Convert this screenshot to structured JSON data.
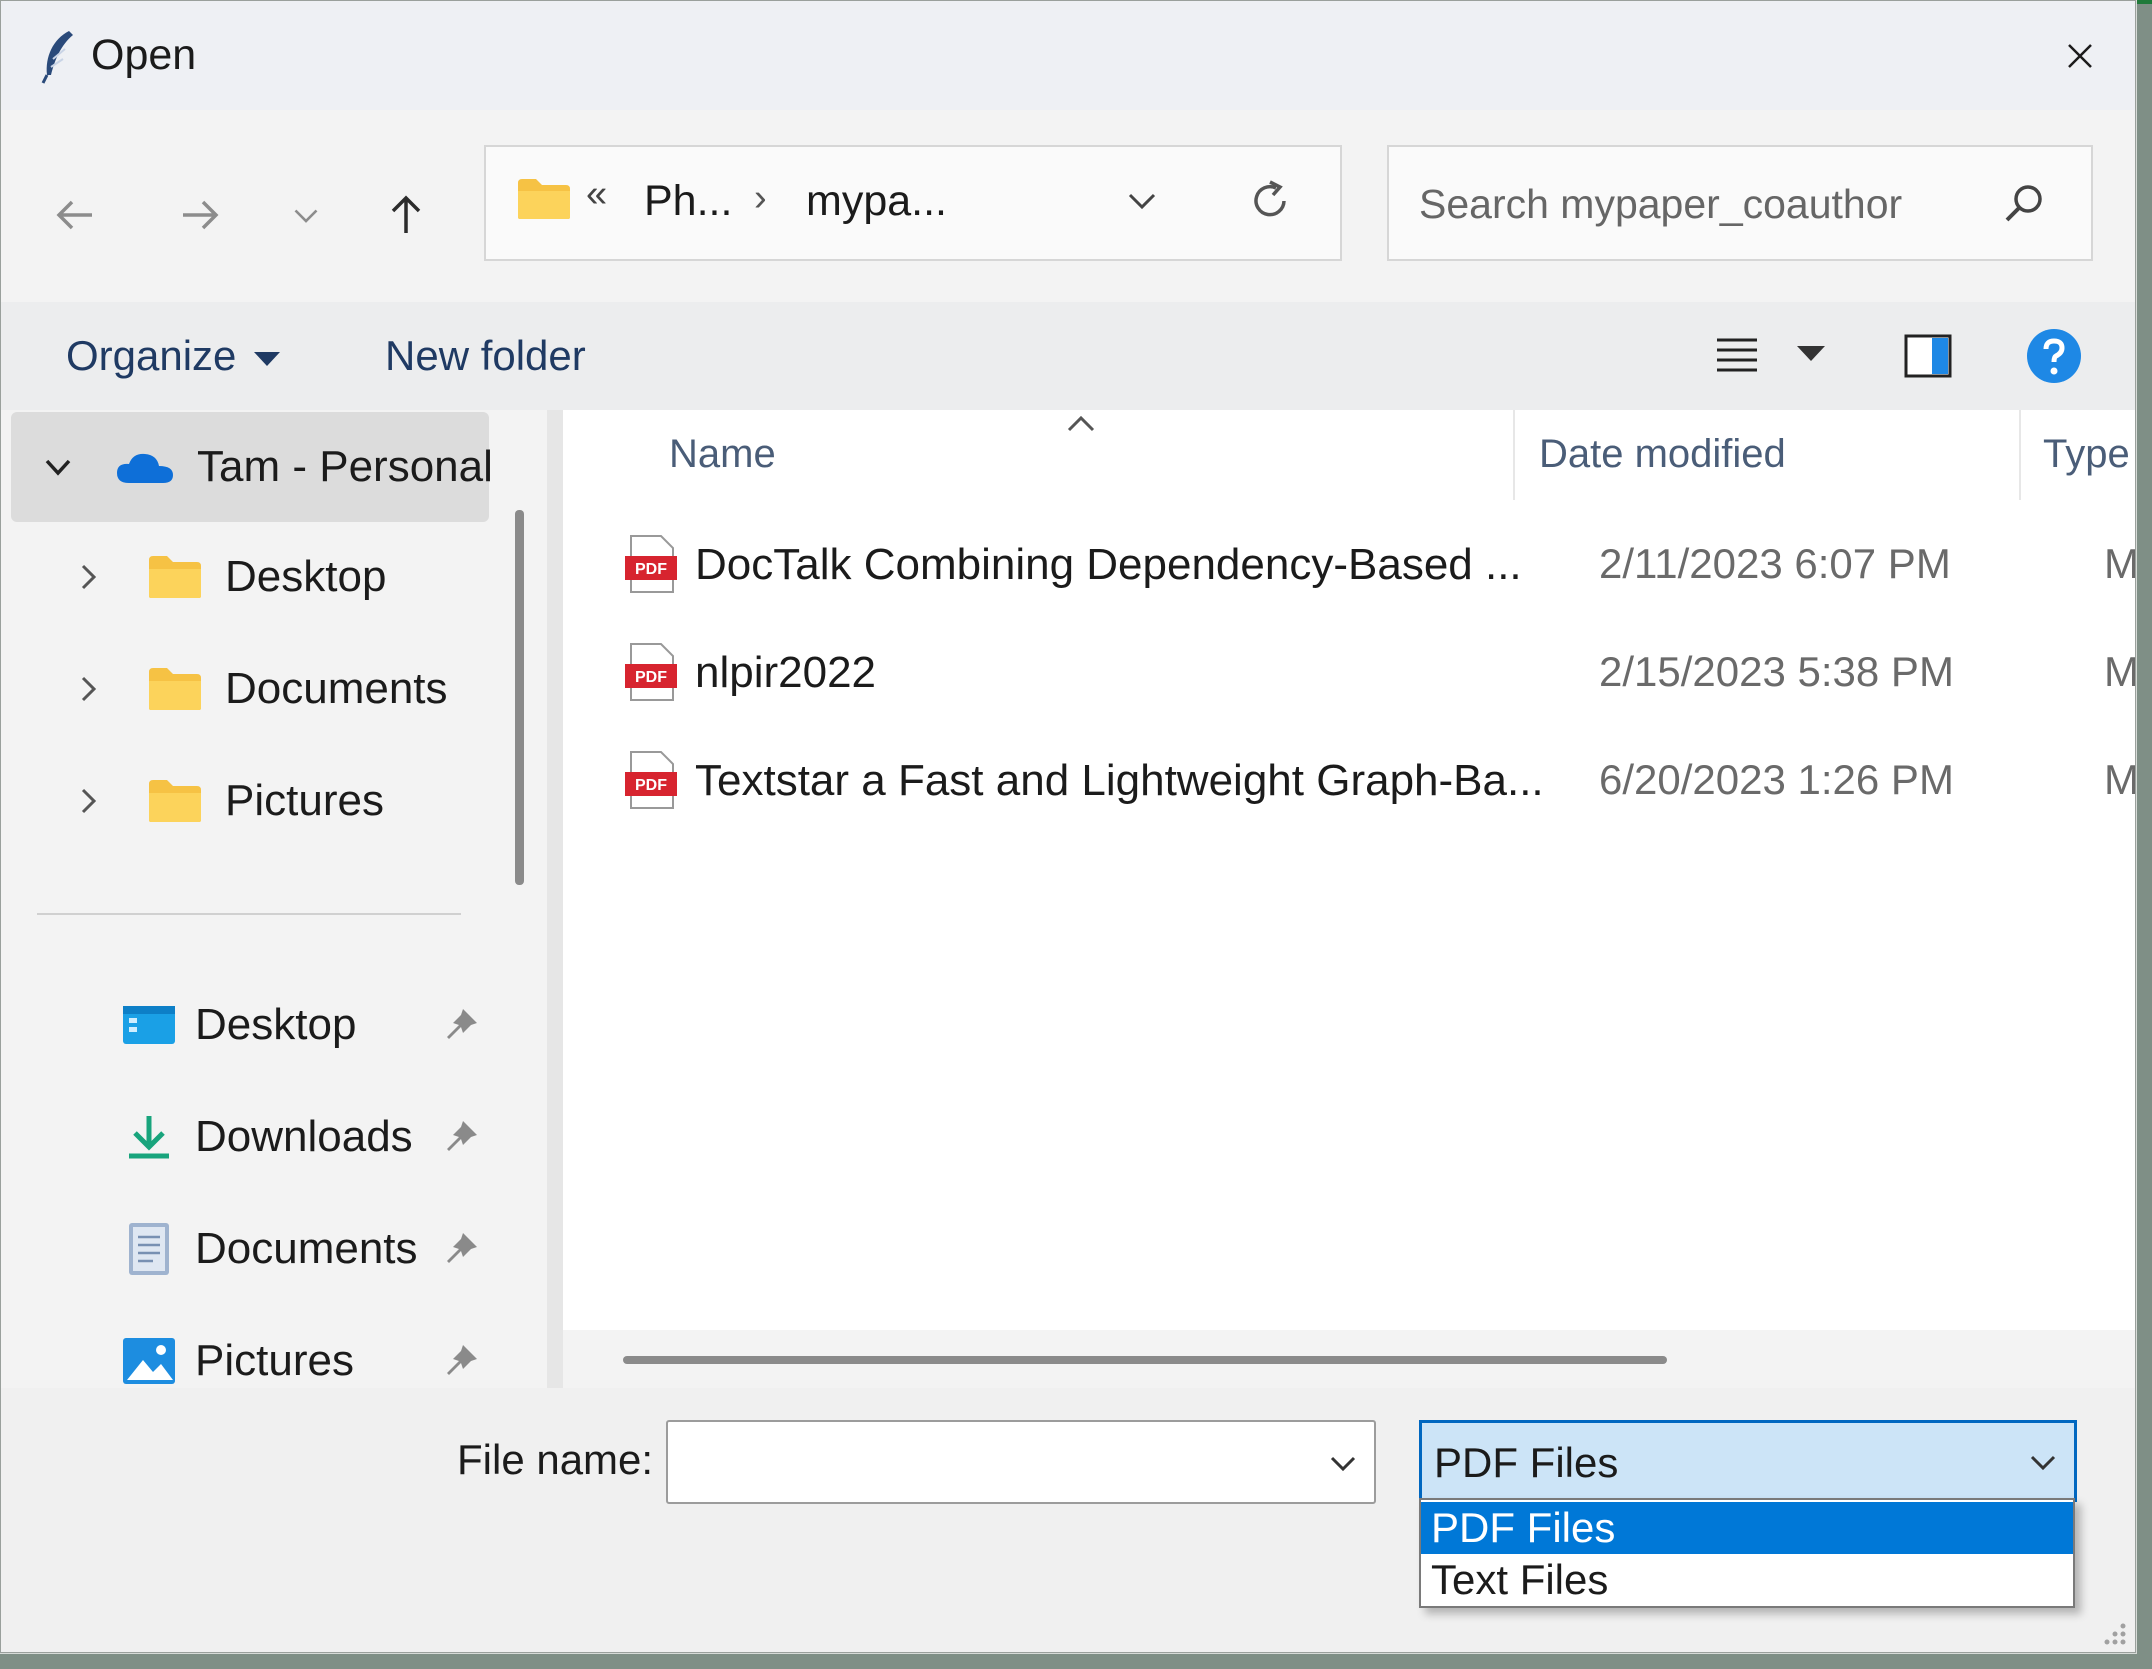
{
  "window": {
    "title": "Open",
    "close_label": "×"
  },
  "nav": {
    "breadcrumb_prefix": "«",
    "breadcrumb": [
      "Ph...",
      "mypa..."
    ],
    "breadcrumb_sep": "›",
    "search_placeholder": "Search mypaper_coauthor"
  },
  "commands": {
    "organize": "Organize",
    "new_folder": "New folder"
  },
  "sidebar": {
    "account": "Tam - Personal",
    "tree": [
      "Desktop",
      "Documents",
      "Pictures"
    ],
    "quick_access": [
      "Desktop",
      "Downloads",
      "Documents",
      "Pictures"
    ]
  },
  "columns": {
    "name": "Name",
    "date": "Date modified",
    "type": "Type"
  },
  "files": [
    {
      "name": "DocTalk Combining Dependency-Based ...",
      "date": "2/11/2023 6:07 PM",
      "type": "Micro"
    },
    {
      "name": "nlpir2022",
      "date": "2/15/2023 5:38 PM",
      "type": "Micro"
    },
    {
      "name": "Textstar a Fast and Lightweight Graph-Ba...",
      "date": "6/20/2023 1:26 PM",
      "type": "Micro"
    }
  ],
  "bottom": {
    "file_name_label": "File name:",
    "file_name_value": "",
    "file_type_selected": "PDF Files",
    "file_type_options": [
      "PDF Files",
      "Text Files"
    ]
  },
  "colors": {
    "accent": "#0078d7",
    "folder": "#f6c244",
    "pdf_red": "#d7242f",
    "onedrive": "#0e6fd8"
  }
}
